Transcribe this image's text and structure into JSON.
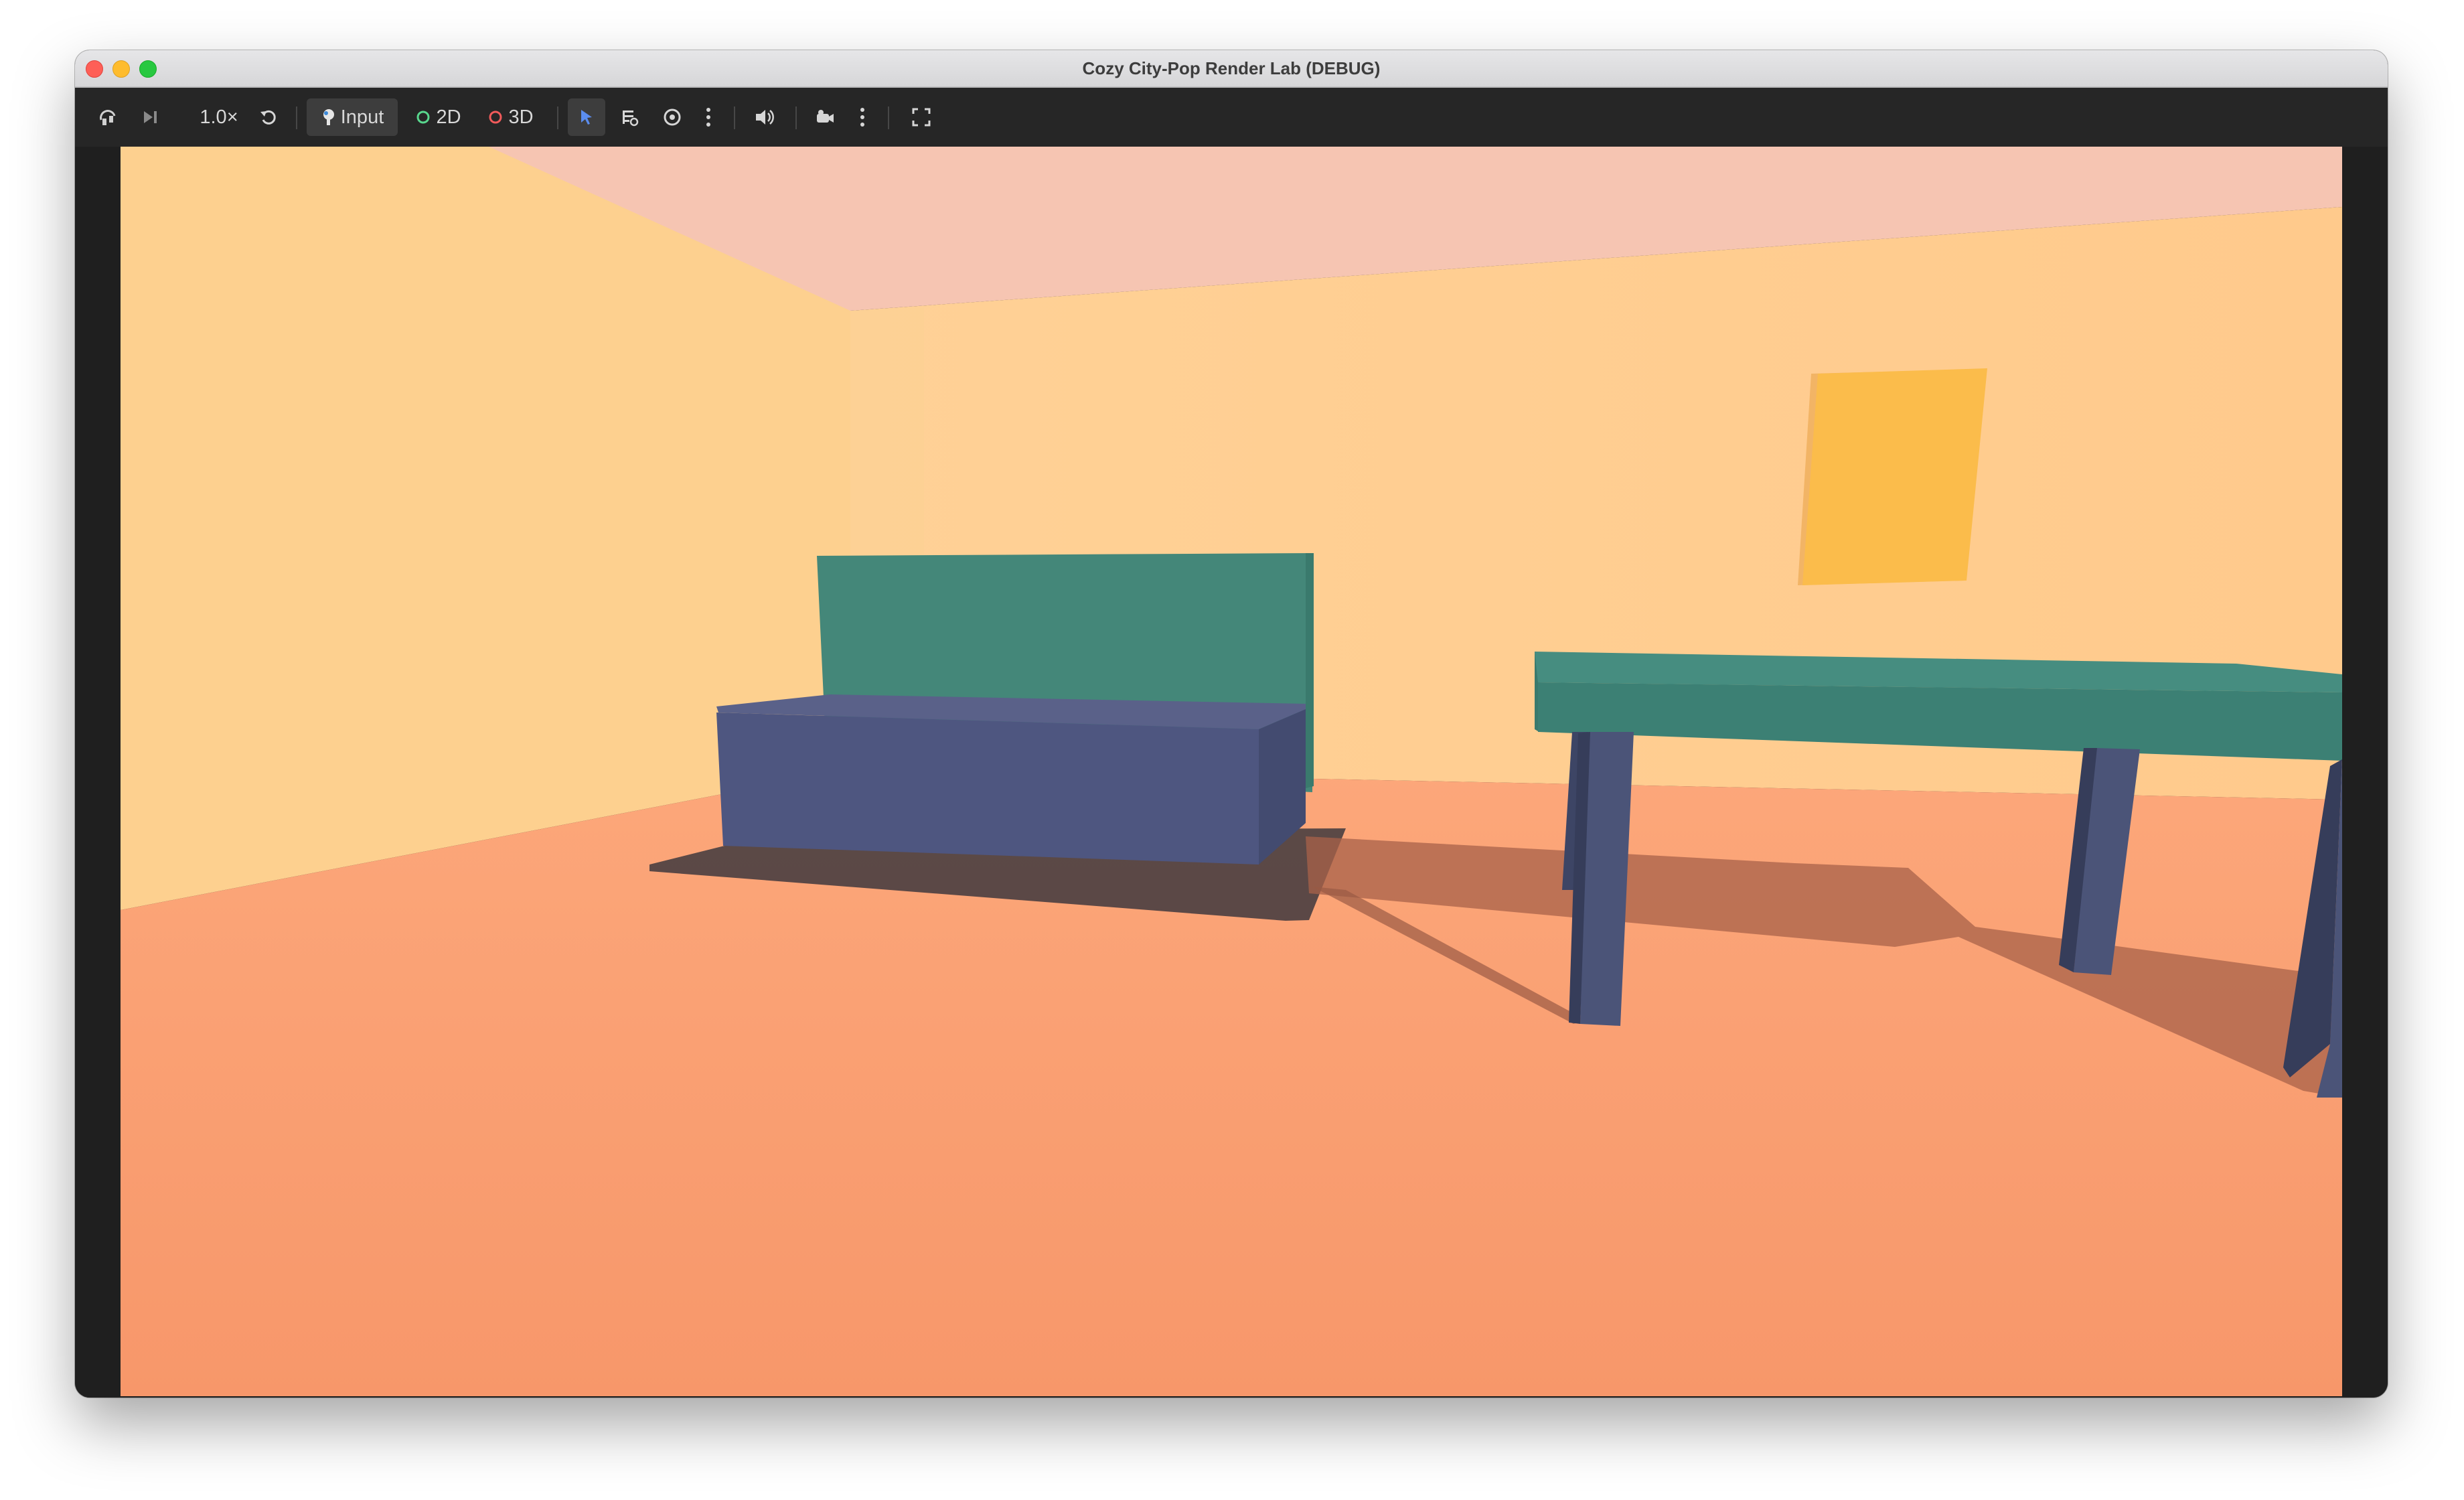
{
  "window": {
    "title": "Cozy City-Pop Render Lab (DEBUG)"
  },
  "toolbar": {
    "speed_label": "1.0×",
    "input_label": "Input",
    "mode_2d_label": "2D",
    "mode_3d_label": "3D",
    "icons": [
      "remote-debug-icon",
      "step-frame-icon",
      "reset-icon",
      "input-icon",
      "circle-2d-icon",
      "circle-3d-icon",
      "select-arrow-icon",
      "list-edit-icon",
      "eye-icon",
      "more-vert-icon",
      "speaker-icon",
      "camera-icon",
      "more-vert-icon",
      "fullscreen-icon"
    ]
  },
  "colors": {
    "mode_2d": "#58d68d",
    "mode_3d": "#f05a5a",
    "select_active": "#5b8def",
    "wall_left": "#fdd08d",
    "wall_back": "#ffcd90",
    "ceiling": "#f6c5b2",
    "floor": "#f89f70",
    "teal": "#3f8a7e",
    "slate": "#4c5679",
    "frame": "#fbbc4b"
  },
  "scene": {
    "objects": [
      "wall-left",
      "wall-back",
      "ceiling",
      "floor",
      "sofa",
      "table",
      "wall-frame"
    ]
  }
}
